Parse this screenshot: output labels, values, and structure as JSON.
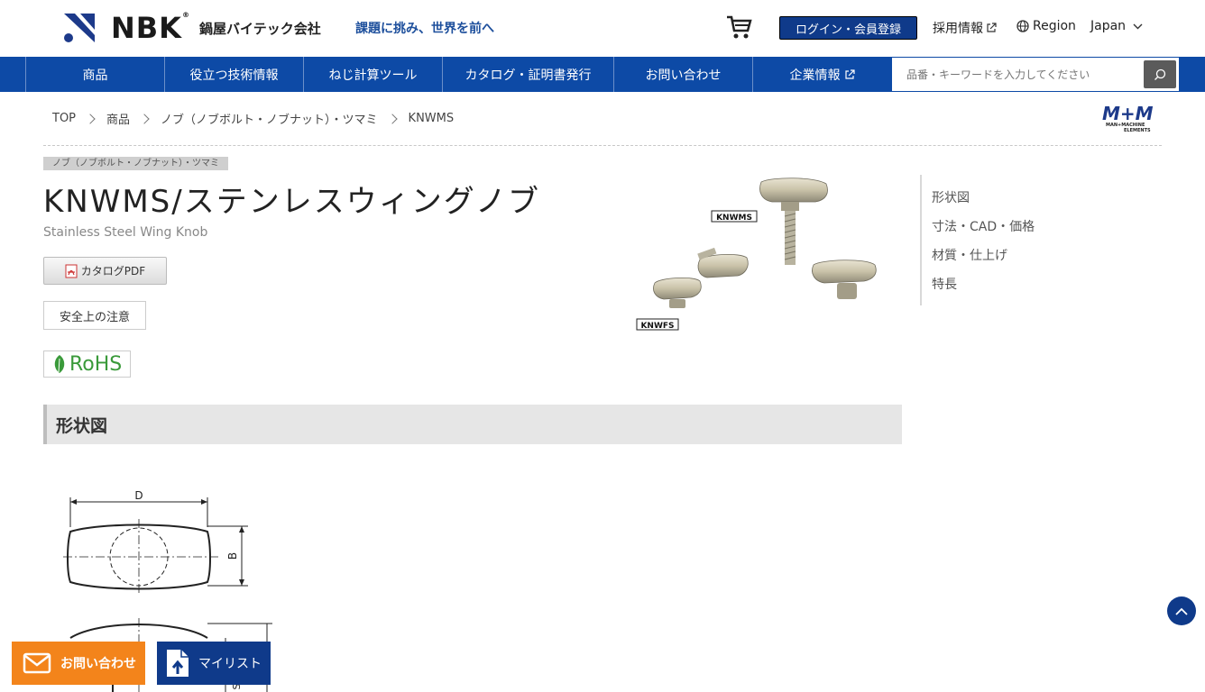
{
  "header": {
    "logo_text": "NBK",
    "logo_reg": "®",
    "company_name": "鍋屋バイテック会社",
    "tagline": "課題に挑み、世界を前へ",
    "login_label": "ログイン・会員登録",
    "recruit_label": "採用情報",
    "region_label": "Region",
    "country_label": "Japan"
  },
  "nav": {
    "items": [
      {
        "label": "商品"
      },
      {
        "label": "役立つ技術情報"
      },
      {
        "label": "ねじ計算ツール"
      },
      {
        "label": "カタログ・証明書発行"
      },
      {
        "label": "お問い合わせ"
      },
      {
        "label": "企業情報"
      }
    ],
    "search_placeholder": "品番・キーワードを入力してください"
  },
  "breadcrumb": [
    "TOP",
    "商品",
    "ノブ（ノブボルト・ノブナット）・ツマミ",
    "KNWMS"
  ],
  "partner_logo": {
    "line1": "MAN+MACHINE",
    "line2": "ELEMENTS"
  },
  "product": {
    "category_tag": "ノブ（ノブボルト・ノブナット）・ツマミ",
    "title": "KNWMS/ステンレスウィングノブ",
    "subtitle": "Stainless Steel Wing Knob",
    "catalog_btn": "カタログPDF",
    "safety_btn": "安全上の注意",
    "rohs": "RoHS",
    "image_labels": [
      "KNWMS",
      "KNWFS"
    ]
  },
  "side_nav": [
    "形状図",
    "寸法・CAD・価格",
    "材質・仕上げ",
    "特長"
  ],
  "section": {
    "title": "形状図"
  },
  "drawing": {
    "dim_d": "D",
    "dim_b": "B",
    "dim_s": "S"
  },
  "floating": {
    "contact": "お問い合わせ",
    "mylist": "マイリスト"
  },
  "colors": {
    "brand_blue": "#0d4aa6",
    "dark_blue": "#0f3a8a",
    "orange": "#f3841b"
  }
}
